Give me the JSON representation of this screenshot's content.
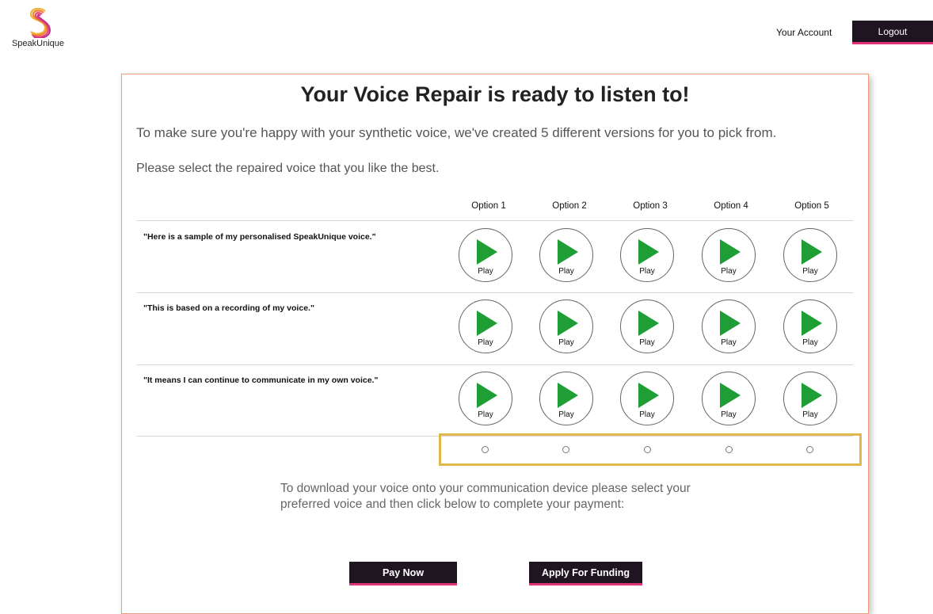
{
  "brand": {
    "name": "SpeakUnique",
    "logo_icon": "speakunique-s-logo",
    "accent_color": "#e0347a"
  },
  "nav": {
    "account_label": "Your Account",
    "logout_label": "Logout"
  },
  "page": {
    "title": "Your Voice Repair is ready to listen to!",
    "intro": "To make sure you're happy with your synthetic voice, we've created 5 different versions for you to pick from.",
    "instruction": "Please select the repaired voice that you like the best."
  },
  "options": [
    "Option 1",
    "Option 2",
    "Option 3",
    "Option 4",
    "Option 5"
  ],
  "samples": [
    {
      "phrase": "\"Here is a sample of my personalised SpeakUnique voice.\""
    },
    {
      "phrase": "\"This is based on a recording of my voice.\""
    },
    {
      "phrase": "\"It means I can continue to communicate in my own voice.\""
    }
  ],
  "play_label": "Play",
  "play_color": "#1e9e35",
  "selection_highlight_color": "#e1b84e",
  "download_text": "To download your voice onto your communication device please select your preferred voice and then click below to complete your payment:",
  "actions": {
    "pay_now": "Pay Now",
    "apply_funding": "Apply For Funding"
  }
}
